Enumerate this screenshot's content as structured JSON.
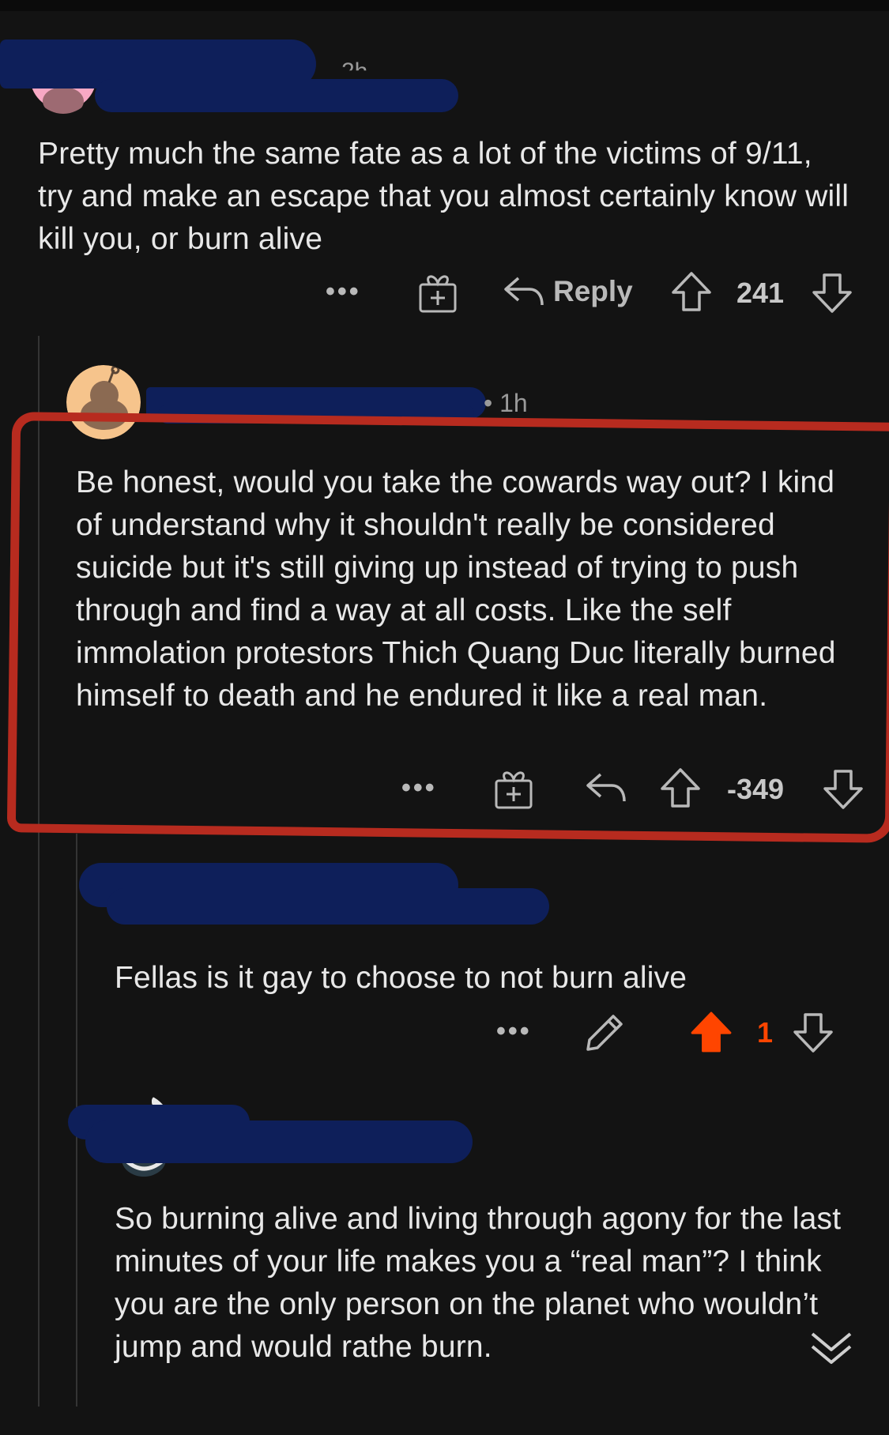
{
  "comments": [
    {
      "id": "c1",
      "timestamp": "2h",
      "body": "Pretty much the same fate as a lot of the victims of 9/11, try and make an escape that you almost certainly know will kill you, or burn alive",
      "actions": {
        "more": "•••",
        "award_icon": "gift-icon",
        "reply_label": "Reply",
        "score": "241"
      }
    },
    {
      "id": "c2",
      "timestamp": "• 1h",
      "body": "Be honest, would you take the cowards way out? I kind of understand why it shouldn't really be considered suicide but it's still giving up instead of trying to push through and find a way at all costs. Like the self immolation protestors Thich Quang Duc literally burned himself to death and he endured it like a real man.",
      "actions": {
        "more": "•••",
        "award_icon": "gift-icon",
        "score": "-349"
      }
    },
    {
      "id": "c3",
      "body": "Fellas is it gay to choose to not burn alive",
      "actions": {
        "more": "•••",
        "edit_icon": "pencil-icon",
        "score": "1",
        "upvoted": true
      }
    },
    {
      "id": "c4",
      "body": "So burning alive and living through agony for the last minutes of your life makes you a “real man”? I think you are the only person on the planet who wouldn’t jump and would rathe burn.",
      "actions": {
        "collapse_icon": "chevron-down-icon"
      }
    }
  ],
  "colors": {
    "background": "#131313",
    "text": "#e8e8e8",
    "meta": "#9a9a9a",
    "upvote_active": "#ff4500",
    "highlight": "#b72b1f",
    "redaction": "#0e1f5a"
  }
}
